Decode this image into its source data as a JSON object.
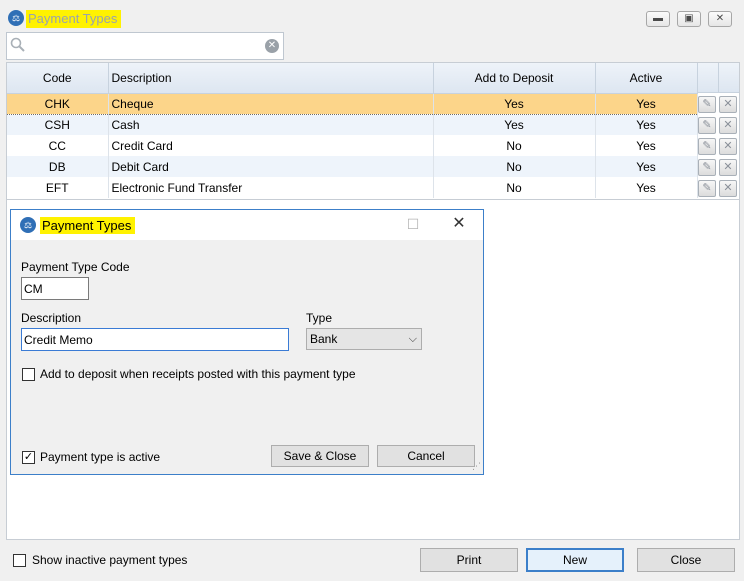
{
  "window": {
    "title": "Payment Types",
    "controls": {
      "minimize": "▭",
      "restore": "⧉",
      "close": "✕"
    }
  },
  "search": {
    "value": "",
    "placeholder": ""
  },
  "grid": {
    "columns": [
      "Code",
      "Description",
      "Add to Deposit",
      "Active"
    ],
    "rows": [
      {
        "code": "CHK",
        "description": "Cheque",
        "add_to_deposit": "Yes",
        "active": "Yes"
      },
      {
        "code": "CSH",
        "description": "Cash",
        "add_to_deposit": "Yes",
        "active": "Yes"
      },
      {
        "code": "CC",
        "description": "Credit Card",
        "add_to_deposit": "No",
        "active": "Yes"
      },
      {
        "code": "DB",
        "description": "Debit Card",
        "add_to_deposit": "No",
        "active": "Yes"
      },
      {
        "code": "EFT",
        "description": "Electronic Fund Transfer",
        "add_to_deposit": "No",
        "active": "Yes"
      }
    ],
    "selected_row": 0
  },
  "dialog": {
    "title": "Payment Types",
    "code_label": "Payment Type Code",
    "code_value": "CM",
    "description_label": "Description",
    "description_value": "Credit Memo",
    "type_label": "Type",
    "type_value": "Bank",
    "deposit_checkbox_label": "Add to deposit when receipts posted with this payment type",
    "deposit_checked": false,
    "active_checkbox_label": "Payment type is active",
    "active_checked": true,
    "save_label": "Save & Close",
    "cancel_label": "Cancel"
  },
  "footer": {
    "show_inactive_label": "Show inactive payment types",
    "show_inactive_checked": false,
    "print_label": "Print",
    "new_label": "New",
    "close_label": "Close"
  },
  "colors": {
    "title_highlight": "#fff200",
    "selected_row": "#fcd58a",
    "accent": "#3c7fc9"
  }
}
